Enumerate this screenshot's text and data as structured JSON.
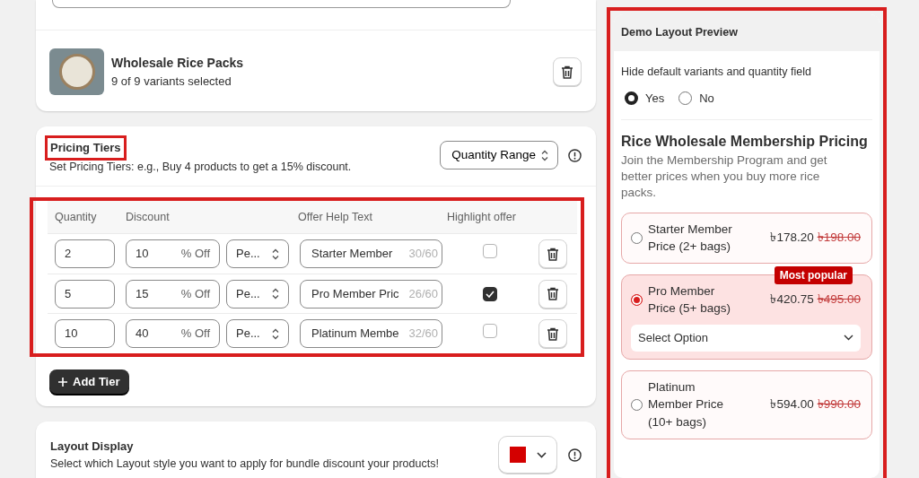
{
  "product": {
    "name": "Wholesale Rice Packs",
    "variants": "9 of 9 variants selected"
  },
  "pricing_tiers": {
    "title": "Pricing Tiers",
    "description": "Set Pricing Tiers: e.g., Buy 4 products to get a 15% discount.",
    "mode": "Quantity Range",
    "columns": [
      "Quantity",
      "Discount",
      "Offer Help Text",
      "Highlight offer"
    ],
    "rows": [
      {
        "quantity": "2",
        "discount": "10",
        "unit": "% Off",
        "apply": "Pe...",
        "help_text": "Starter Member",
        "count": "30/60",
        "highlight": false
      },
      {
        "quantity": "5",
        "discount": "15",
        "unit": "% Off",
        "apply": "Pe...",
        "help_text": "Pro Member Pric",
        "count": "26/60",
        "highlight": true
      },
      {
        "quantity": "10",
        "discount": "40",
        "unit": "% Off",
        "apply": "Pe...",
        "help_text": "Platinum Membe",
        "count": "32/60",
        "highlight": false
      }
    ],
    "add_button": "Add Tier"
  },
  "layout_display": {
    "title": "Layout Display",
    "description": "Select which Layout style you want to apply for bundle discount your products!",
    "color": "#d40000"
  },
  "preview": {
    "title": "Demo Layout Preview",
    "question": "Hide default variants and quantity field",
    "options": [
      {
        "label": "Yes",
        "selected": true
      },
      {
        "label": "No",
        "selected": false
      }
    ],
    "heading": "Rice Wholesale Membership Pricing",
    "description": "Join the Membership Program and get better prices when you buy more rice packs.",
    "tiers": [
      {
        "label": "Starter Member Price (2+ bags)",
        "price": "৳178.20",
        "compare_price": "৳198.00",
        "selected": false
      },
      {
        "label": "Pro Member Price (5+ bags)",
        "price": "৳420.75",
        "compare_price": "৳495.00",
        "selected": true,
        "badge": "Most popular",
        "select": "Select Option"
      },
      {
        "label": "Platinum Member Price (10+ bags)",
        "price": "৳594.00",
        "compare_price": "৳990.00",
        "selected": false
      }
    ]
  }
}
